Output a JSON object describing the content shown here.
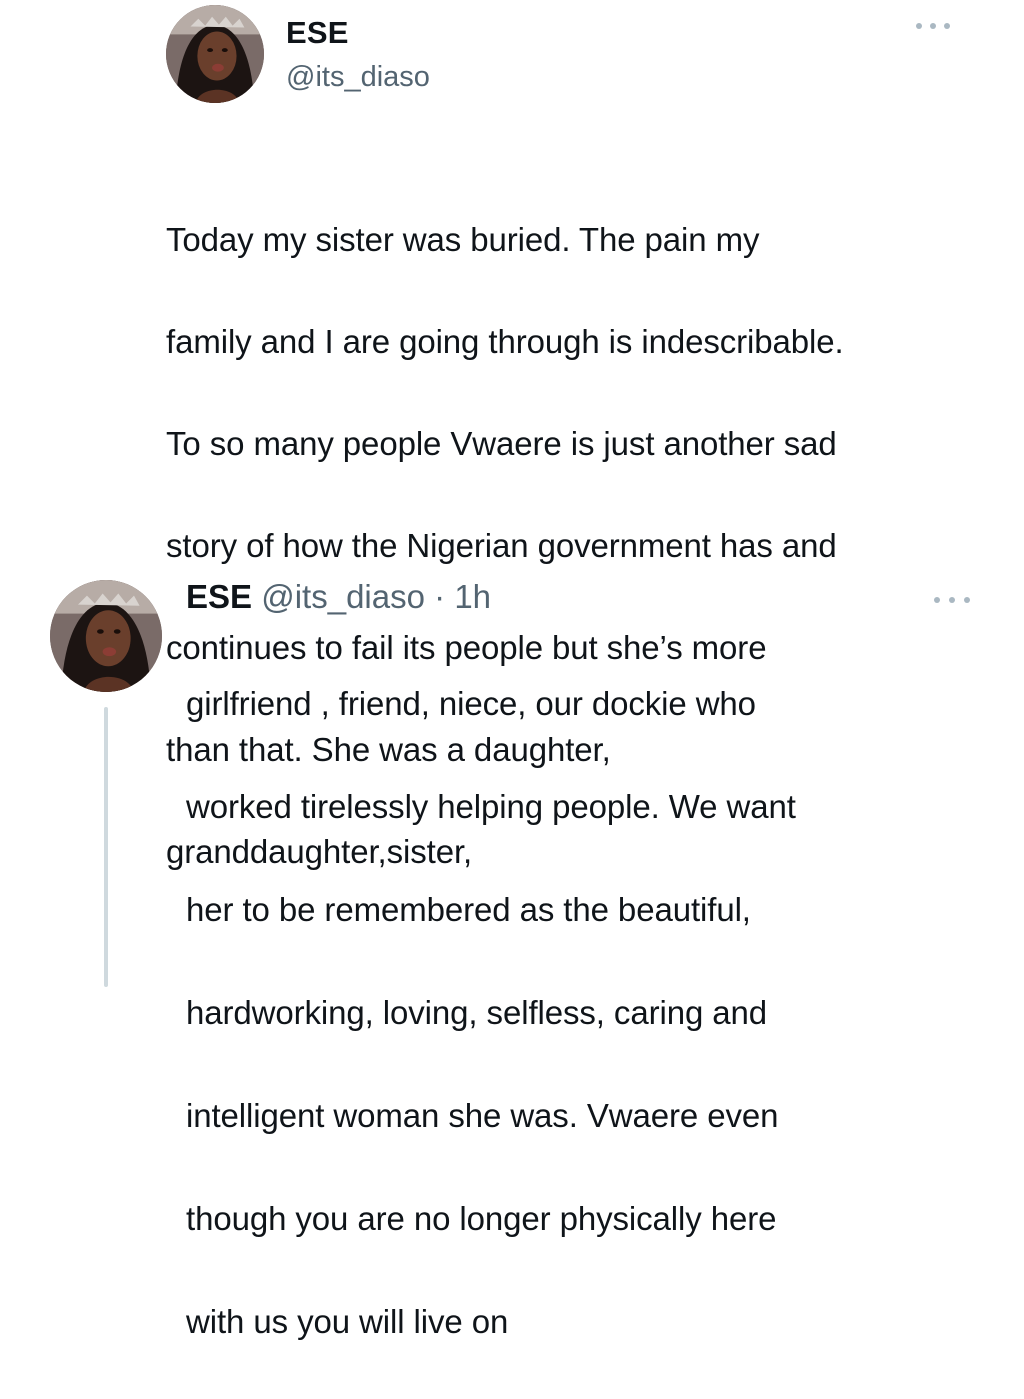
{
  "main_tweet": {
    "name": "ESE",
    "handle": "@its_diaso",
    "body_lines": [
      "Today my sister was buried. The pain my",
      "family and I are going through is indescribable.",
      "To so many people Vwaere is just another sad",
      "story of how the Nigerian government has and",
      "continues to fail its people but she’s more",
      "than that. She was a daughter,",
      "granddaughter,sister,"
    ],
    "more_icon": "more-horizontal-icon"
  },
  "reply_tweet": {
    "name": "ESE",
    "handle": "@its_diaso",
    "separator": "·",
    "time": "1h",
    "body_lines": [
      "girlfriend , friend, niece, our dockie who",
      "worked tirelessly helping people. We want",
      "her to be remembered as the beautiful,",
      "hardworking, loving, selfless, caring and",
      "intelligent woman she was. Vwaere even",
      "though you are no longer physically here",
      "with us you will live on"
    ],
    "more_icon": "more-horizontal-icon"
  },
  "colors": {
    "text_primary": "#0f1419",
    "text_secondary": "#536471",
    "thread_line": "#cfd9de",
    "background": "#ffffff"
  }
}
